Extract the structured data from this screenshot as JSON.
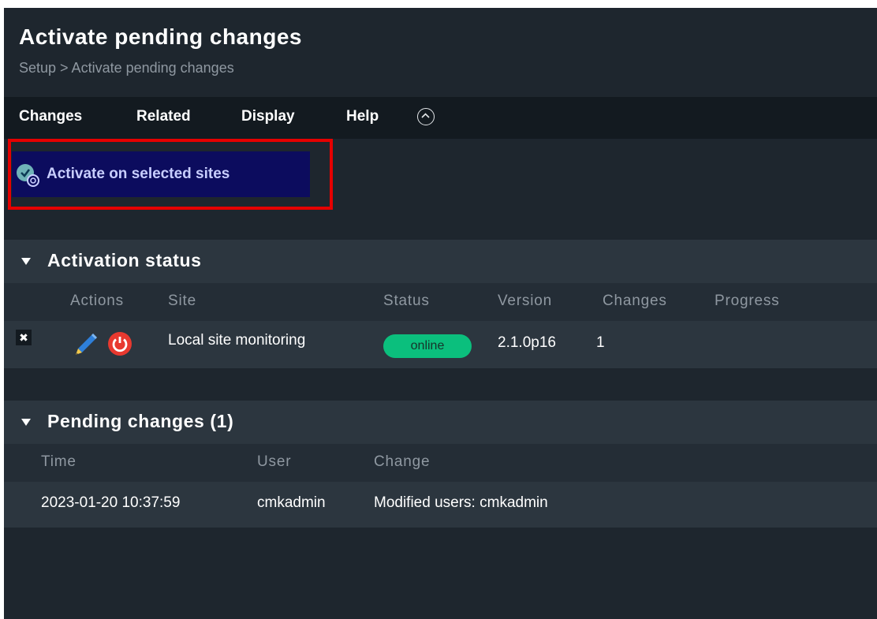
{
  "page": {
    "title": "Activate pending changes",
    "breadcrumb": "Setup > Activate pending changes"
  },
  "menu": {
    "items": [
      "Changes",
      "Related",
      "Display",
      "Help"
    ]
  },
  "activate_button": {
    "label": "Activate on selected sites"
  },
  "activation_status": {
    "title": "Activation status",
    "columns": {
      "actions": "Actions",
      "site": "Site",
      "status": "Status",
      "version": "Version",
      "changes": "Changes",
      "progress": "Progress"
    },
    "rows": [
      {
        "remove_symbol": "✖",
        "site": "Local site monitoring",
        "status": "online",
        "version": "2.1.0p16",
        "changes": "1",
        "progress": ""
      }
    ]
  },
  "pending_changes": {
    "title": "Pending changes (1)",
    "columns": {
      "time": "Time",
      "user": "User",
      "change": "Change"
    },
    "rows": [
      {
        "time": "2023-01-20 10:37:59",
        "user": "cmkadmin",
        "change": "Modified users: cmkadmin"
      }
    ]
  },
  "icons": {
    "collapse": "chevron-up-circle-icon",
    "activate": "activate-changes-icon",
    "remove": "close-icon",
    "edit": "pencil-icon",
    "restart": "restart-icon",
    "section_toggle": "triangle-down-icon"
  },
  "colors": {
    "background": "#1e262e",
    "menubar": "#131a20",
    "section": "#2c363f",
    "status_online": "#0bbf7d",
    "activate_button_bg": "#0c0c5e",
    "activate_button_text": "#c8ceff",
    "highlight_frame": "#e50000",
    "restart_icon": "#e8392f"
  }
}
